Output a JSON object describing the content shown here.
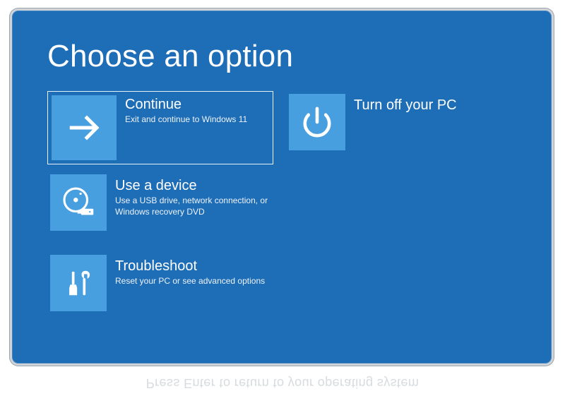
{
  "colors": {
    "background": "#1e6db7",
    "tile_accent": "#489fe0",
    "text": "#ffffff"
  },
  "page": {
    "title": "Choose an option"
  },
  "options": {
    "continue": {
      "label": "Continue",
      "desc": "Exit and continue to Windows 11",
      "icon": "arrow-right-icon",
      "selected": true
    },
    "turn_off": {
      "label": "Turn off your PC",
      "desc": "",
      "icon": "power-icon",
      "selected": false
    },
    "use_device": {
      "label": "Use a device",
      "desc": "Use a USB drive, network connection, or Windows recovery DVD",
      "icon": "disc-usb-icon",
      "selected": false
    },
    "troubleshoot": {
      "label": "Troubleshoot",
      "desc": "Reset your PC or see advanced options",
      "icon": "tools-icon",
      "selected": false
    }
  },
  "reflection_text": "Press Enter to return to your operating system"
}
